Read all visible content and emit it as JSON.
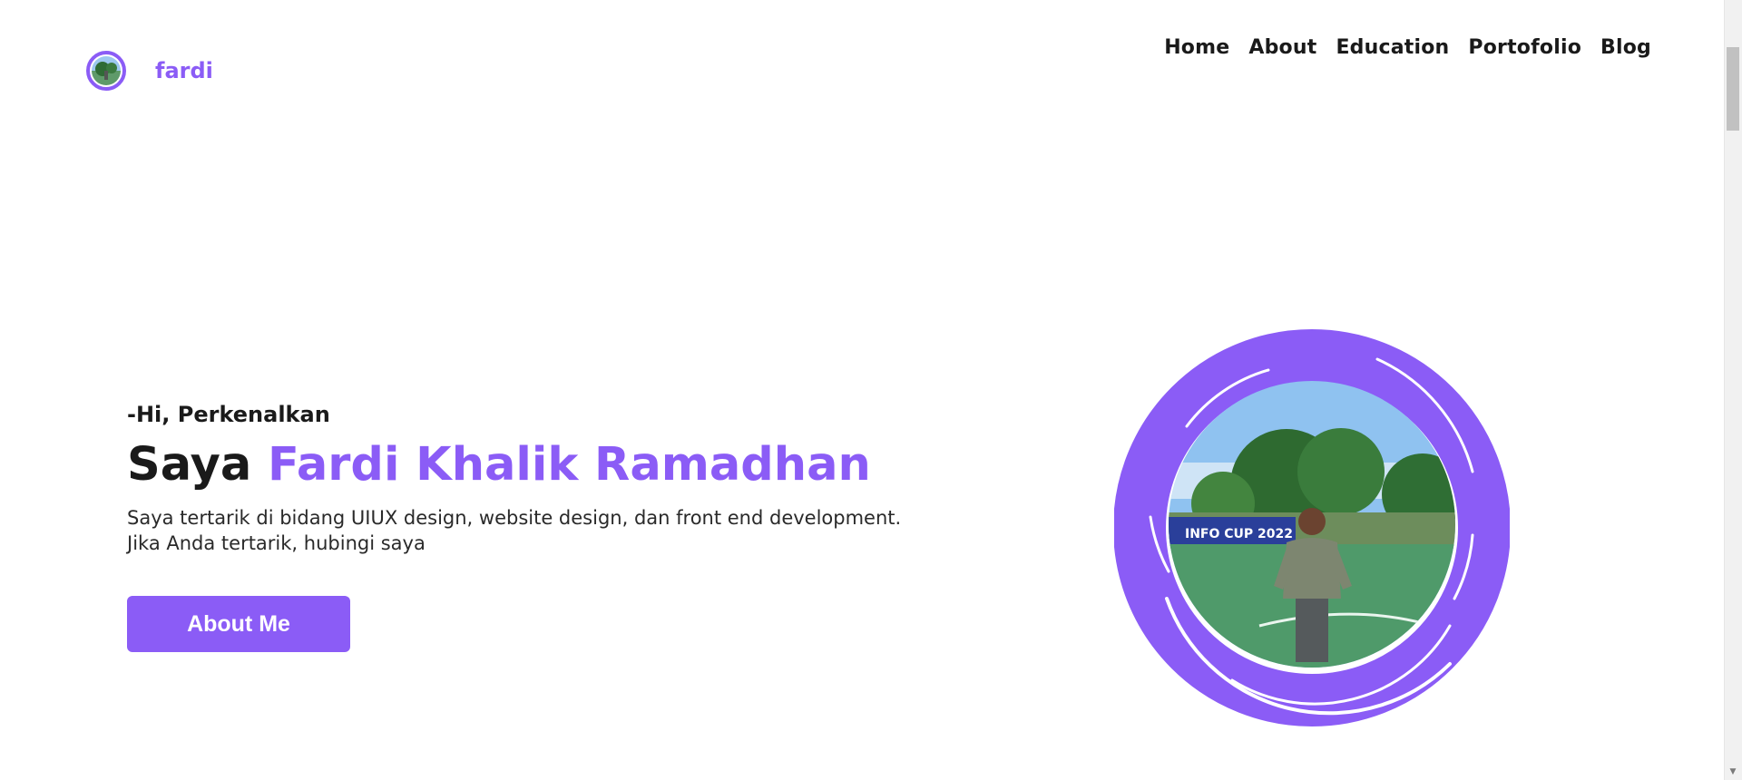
{
  "brand": {
    "name": "fardi",
    "logo_icon": "avatar-ring-icon",
    "accent": "#8b5cf6"
  },
  "nav": {
    "items": [
      {
        "label": "Home"
      },
      {
        "label": "About"
      },
      {
        "label": "Education"
      },
      {
        "label": "Portofolio"
      },
      {
        "label": "Blog"
      }
    ]
  },
  "hero": {
    "greeting": "-Hi, Perkenalkan",
    "headline_prefix": "Saya",
    "headline_name": "Fardi Khalik Ramadhan",
    "description_line1": "Saya tertarik di bidang UIUX design, website design, dan front end development.",
    "description_line2": "Jika Anda tertarik, hubingi saya",
    "cta_label": "About Me",
    "photo_banner_text": "INFO CUP 2022"
  },
  "colors": {
    "accent": "#8b5cf6",
    "text": "#1a1a1a",
    "background": "#ffffff"
  }
}
